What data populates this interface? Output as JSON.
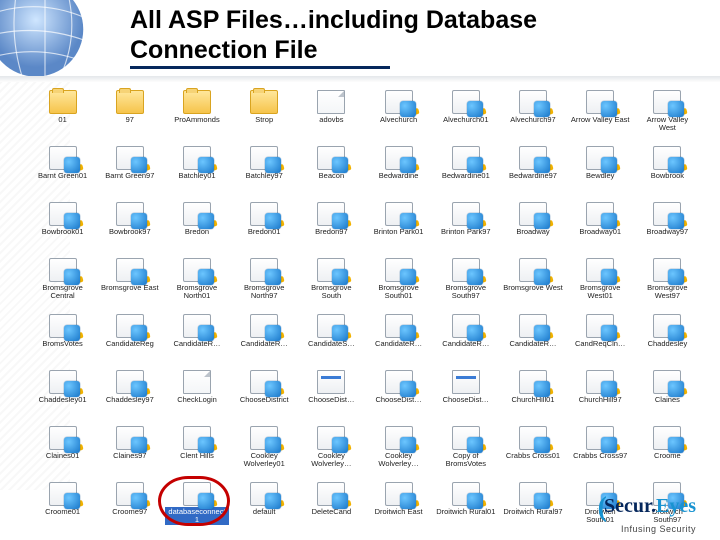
{
  "title_line1": "All ASP Files…including Database",
  "title_line2": "Connection File",
  "footer": {
    "brand_html": "Secur.Eyes",
    "tagline": "Infusing Security"
  },
  "highlight_index": 72,
  "items": [
    {
      "label": "01",
      "type": "fold"
    },
    {
      "label": "97",
      "type": "fold"
    },
    {
      "label": "ProAmmonds",
      "type": "fold"
    },
    {
      "label": "Strop",
      "type": "fold"
    },
    {
      "label": "adovbs",
      "type": "file"
    },
    {
      "label": "Alvechurch",
      "type": "asp"
    },
    {
      "label": "Alvechurch01",
      "type": "asp"
    },
    {
      "label": "Alvechurch97",
      "type": "asp"
    },
    {
      "label": "Arrow Valley East",
      "type": "asp"
    },
    {
      "label": "Arrow Valley West",
      "type": "asp"
    },
    {
      "label": "Barnt Green01",
      "type": "asp"
    },
    {
      "label": "Barnt Green97",
      "type": "asp"
    },
    {
      "label": "Batchley01",
      "type": "asp"
    },
    {
      "label": "Batchley97",
      "type": "asp"
    },
    {
      "label": "Beacon",
      "type": "asp"
    },
    {
      "label": "Bedwardine",
      "type": "asp"
    },
    {
      "label": "Bedwardine01",
      "type": "asp"
    },
    {
      "label": "Bedwardine97",
      "type": "asp"
    },
    {
      "label": "Bewdley",
      "type": "asp"
    },
    {
      "label": "Bowbrook",
      "type": "asp"
    },
    {
      "label": "Bowbrook01",
      "type": "asp"
    },
    {
      "label": "Bowbrook97",
      "type": "asp"
    },
    {
      "label": "Bredon",
      "type": "asp"
    },
    {
      "label": "Bredon01",
      "type": "asp"
    },
    {
      "label": "Bredon97",
      "type": "asp"
    },
    {
      "label": "Brinton Park01",
      "type": "asp"
    },
    {
      "label": "Brinton Park97",
      "type": "asp"
    },
    {
      "label": "Broadway",
      "type": "asp"
    },
    {
      "label": "Broadway01",
      "type": "asp"
    },
    {
      "label": "Broadway97",
      "type": "asp"
    },
    {
      "label": "Bromsgrove Central",
      "type": "asp"
    },
    {
      "label": "Bromsgrove East",
      "type": "asp"
    },
    {
      "label": "Bromsgrove North01",
      "type": "asp"
    },
    {
      "label": "Bromsgrove North97",
      "type": "asp"
    },
    {
      "label": "Bromsgrove South",
      "type": "asp"
    },
    {
      "label": "Bromsgrove South01",
      "type": "asp"
    },
    {
      "label": "Bromsgrove South97",
      "type": "asp"
    },
    {
      "label": "Bromsgrove West",
      "type": "asp"
    },
    {
      "label": "Bromsgrove West01",
      "type": "asp"
    },
    {
      "label": "Bromsgrove West97",
      "type": "asp"
    },
    {
      "label": "BromsVotes",
      "type": "asp"
    },
    {
      "label": "CandidateReg",
      "type": "asp"
    },
    {
      "label": "CandidateR…",
      "type": "asp"
    },
    {
      "label": "CandidateR…",
      "type": "asp"
    },
    {
      "label": "CandidateS…",
      "type": "asp"
    },
    {
      "label": "CandidateR…",
      "type": "asp"
    },
    {
      "label": "CandidateR…",
      "type": "asp"
    },
    {
      "label": "CandidateR…",
      "type": "asp"
    },
    {
      "label": "CandReqCln…",
      "type": "asp"
    },
    {
      "label": "Chaddesley",
      "type": "asp"
    },
    {
      "label": "Chaddesley01",
      "type": "asp"
    },
    {
      "label": "Chaddesley97",
      "type": "asp"
    },
    {
      "label": "CheckLogin",
      "type": "file"
    },
    {
      "label": "ChooseDistrict",
      "type": "asp"
    },
    {
      "label": "ChooseDist…",
      "type": "htm"
    },
    {
      "label": "ChooseDist…",
      "type": "asp"
    },
    {
      "label": "ChooseDist…",
      "type": "htm"
    },
    {
      "label": "ChurchHill01",
      "type": "asp"
    },
    {
      "label": "ChurchHill97",
      "type": "asp"
    },
    {
      "label": "Claines",
      "type": "asp"
    },
    {
      "label": "Claines01",
      "type": "asp"
    },
    {
      "label": "Claines97",
      "type": "asp"
    },
    {
      "label": "Clent Hills",
      "type": "asp"
    },
    {
      "label": "Cookley Wolverley01",
      "type": "asp"
    },
    {
      "label": "Cookley Wolverley…",
      "type": "asp"
    },
    {
      "label": "Cookley Wolverley…",
      "type": "asp"
    },
    {
      "label": "Copy of BromsVotes",
      "type": "asp"
    },
    {
      "label": "Crabbs Cross01",
      "type": "asp"
    },
    {
      "label": "Crabbs Cross97",
      "type": "asp"
    },
    {
      "label": "Croome",
      "type": "asp"
    },
    {
      "label": "Croome01",
      "type": "asp"
    },
    {
      "label": "Croome97",
      "type": "asp"
    },
    {
      "label": "databaseconnect1",
      "type": "asp",
      "selected": true
    },
    {
      "label": "default",
      "type": "asp"
    },
    {
      "label": "DeleteCand",
      "type": "asp"
    },
    {
      "label": "Droitwich East",
      "type": "asp"
    },
    {
      "label": "Droitwich Rural01",
      "type": "asp"
    },
    {
      "label": "Droitwich Rural97",
      "type": "asp"
    },
    {
      "label": "Droitwich South01",
      "type": "asp"
    },
    {
      "label": "Droitwich South97",
      "type": "asp"
    }
  ]
}
